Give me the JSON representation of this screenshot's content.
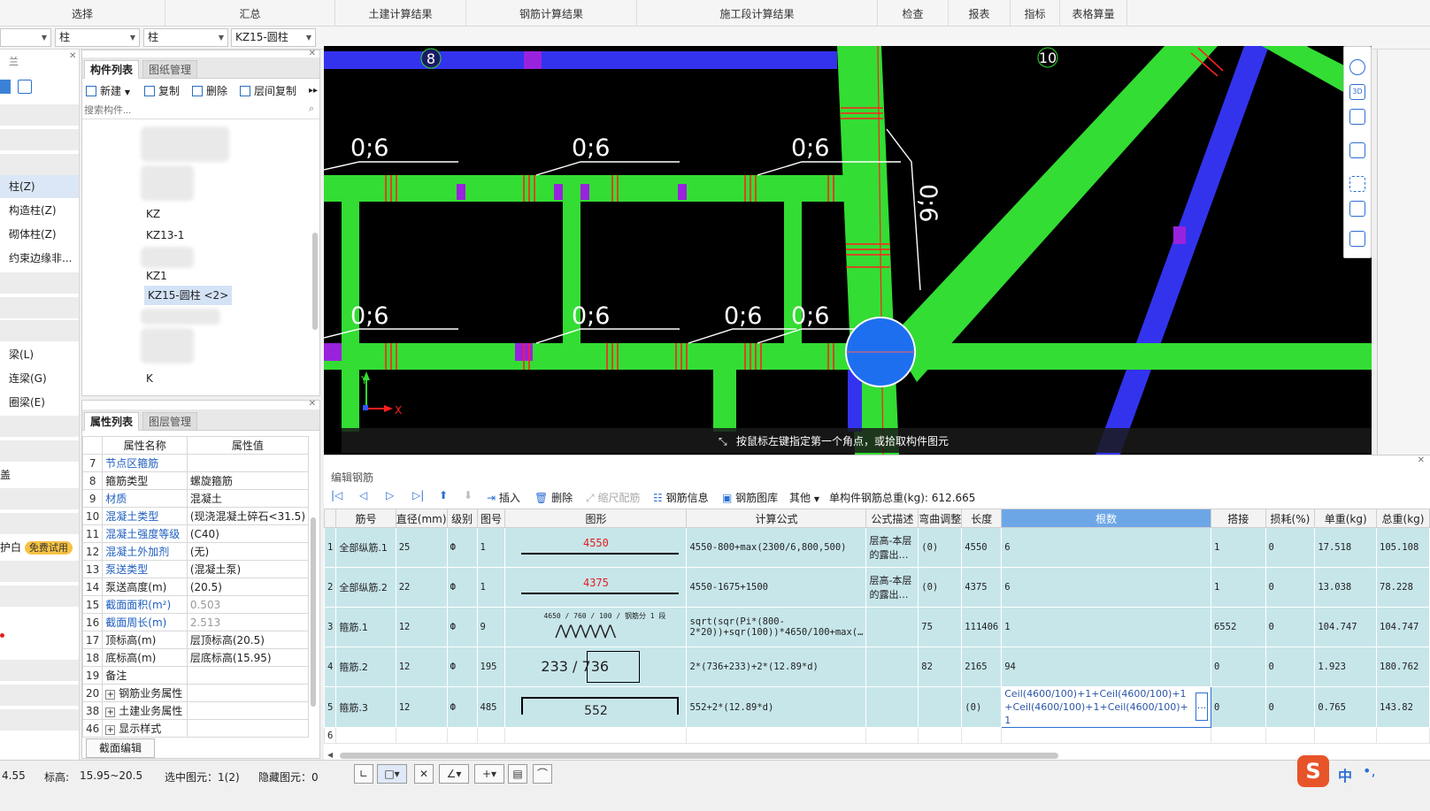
{
  "ribbon": [
    "选择",
    "汇总",
    "土建计算结果",
    "钢筋计算结果",
    "施工段计算结果",
    "检查",
    "报表",
    "指标",
    "表格算量"
  ],
  "selectors": {
    "first": "",
    "second": "柱",
    "third": "柱",
    "fourth": "KZ15-圆柱"
  },
  "nav": {
    "top_label": "兰",
    "items": [
      "柱(Z)",
      "构造柱(Z)",
      "砌体柱(Z)",
      "约束边缘非...",
      "梁(L)",
      "连梁(G)",
      "圈梁(E)",
      "盖",
      "护白"
    ],
    "badge": "免费试用"
  },
  "comp_panel": {
    "tabs": [
      "构件列表",
      "图纸管理"
    ],
    "toolbar": [
      "新建",
      "复制",
      "删除",
      "层间复制"
    ],
    "search_placeholder": "搜索构件...",
    "items": [
      "KZ",
      "KZ13-1",
      "KZ15-圆柱 <2>",
      "KZ1",
      "K",
      "K"
    ]
  },
  "prop_panel": {
    "tabs": [
      "属性列表",
      "图层管理"
    ],
    "headers": [
      "属性名称",
      "属性值"
    ],
    "rows": [
      {
        "n": "7",
        "name": "节点区箍筋",
        "val": "",
        "link": true
      },
      {
        "n": "8",
        "name": "箍筋类型",
        "val": "螺旋箍筋",
        "link": false
      },
      {
        "n": "9",
        "name": "材质",
        "val": "混凝土",
        "link": true
      },
      {
        "n": "10",
        "name": "混凝土类型",
        "val": "(现浇混凝土碎石<31.5)",
        "link": true
      },
      {
        "n": "11",
        "name": "混凝土强度等级",
        "val": "(C40)",
        "link": true
      },
      {
        "n": "12",
        "name": "混凝土外加剂",
        "val": "(无)",
        "link": true
      },
      {
        "n": "13",
        "name": "泵送类型",
        "val": "(混凝土泵)",
        "link": true
      },
      {
        "n": "14",
        "name": "泵送高度(m)",
        "val": "(20.5)",
        "link": false
      },
      {
        "n": "15",
        "name": "截面面积(m²)",
        "val": "0.503",
        "link": true,
        "gray": true
      },
      {
        "n": "16",
        "name": "截面周长(m)",
        "val": "2.513",
        "link": true,
        "gray": true
      },
      {
        "n": "17",
        "name": "顶标高(m)",
        "val": "层顶标高(20.5)",
        "link": false
      },
      {
        "n": "18",
        "name": "底标高(m)",
        "val": "层底标高(15.95)",
        "link": false
      },
      {
        "n": "19",
        "name": "备注",
        "val": "",
        "link": false
      },
      {
        "n": "20",
        "name": "钢筋业务属性",
        "val": "",
        "link": false,
        "exp": true
      },
      {
        "n": "38",
        "name": "土建业务属性",
        "val": "",
        "link": false,
        "exp": true
      },
      {
        "n": "46",
        "name": "显示样式",
        "val": "",
        "link": false,
        "exp": true
      }
    ],
    "edit_button": "截面编辑"
  },
  "canvas": {
    "axis_labels": [
      "8",
      "10"
    ],
    "rebar_labels": [
      "0;6",
      "0;6",
      "0;6",
      "0;6",
      "0;6",
      "0;6",
      "0;6",
      "0;6",
      "0;6"
    ],
    "hint": "按鼠标左键指定第一个角点，或拾取构件图元",
    "axis_x": "X",
    "axis_y": "Y"
  },
  "rebar_panel": {
    "title": "编辑钢筋",
    "toolbar": [
      "插入",
      "删除",
      "缩尺配筋",
      "钢筋信息",
      "钢筋图库",
      "其他"
    ],
    "total": "单构件钢筋总重(kg): 612.665",
    "headers": [
      "",
      "筋号",
      "直径(mm)",
      "级别",
      "图号",
      "图形",
      "计算公式",
      "公式描述",
      "弯曲调整",
      "长度",
      "根数",
      "搭接",
      "损耗(%)",
      "单重(kg)",
      "总重(kg)"
    ],
    "rows": [
      {
        "idx": "1",
        "name": "全部纵筋.1",
        "dia": "25",
        "grade": "Ф",
        "fig": "1",
        "shape": "4550",
        "formula": "4550-800+max(2300/6,800,500)",
        "desc": "层高-本层的露出…",
        "bend": "(0)",
        "len": "4550",
        "count": "6",
        "lap": "1",
        "loss": "0",
        "unit": "17.518",
        "total": "105.108"
      },
      {
        "idx": "2",
        "name": "全部纵筋.2",
        "dia": "22",
        "grade": "Ф",
        "fig": "1",
        "shape": "4375",
        "formula": "4550-1675+1500",
        "desc": "层高-本层的露出…",
        "bend": "(0)",
        "len": "4375",
        "count": "6",
        "lap": "1",
        "loss": "0",
        "unit": "13.038",
        "total": "78.228"
      },
      {
        "idx": "3",
        "name": "箍筋.1",
        "dia": "12",
        "grade": "Ф",
        "fig": "9",
        "shape": "4650 / 760 / 100 / 钢筋分 1 段",
        "formula": "sqrt(sqr(Pi*(800-2*20))+sqr(100))*4650/100+max(…",
        "desc": "",
        "bend": "75",
        "len": "111406",
        "count": "1",
        "lap": "6552",
        "loss": "0",
        "unit": "104.747",
        "total": "104.747"
      },
      {
        "idx": "4",
        "name": "箍筋.2",
        "dia": "12",
        "grade": "Ф",
        "fig": "195",
        "shape": "233 / 736",
        "formula": "2*(736+233)+2*(12.89*d)",
        "desc": "",
        "bend": "82",
        "len": "2165",
        "count": "94",
        "lap": "0",
        "loss": "0",
        "unit": "1.923",
        "total": "180.762"
      },
      {
        "idx": "5",
        "name": "箍筋.3",
        "dia": "12",
        "grade": "Ф",
        "fig": "485",
        "shape": "552",
        "formula": "552+2*(12.89*d)",
        "desc": "",
        "bend": "",
        "len": "(0)",
        "count": "Ceil(4600/100)+1+Ceil(4600/100)+1+Ceil(4600/100)+1+Ceil(4600/100)+1",
        "lap": "0",
        "loss": "0",
        "unit": "0.765",
        "total": "143.82"
      },
      {
        "idx": "6",
        "name": "",
        "dia": "",
        "grade": "",
        "fig": "",
        "shape": "",
        "formula": "",
        "desc": "",
        "bend": "",
        "len": "",
        "count": "",
        "lap": "",
        "loss": "",
        "unit": "",
        "total": ""
      }
    ]
  },
  "status": {
    "coord": "4.55",
    "elev_label": "标高:",
    "elev": "15.95~20.5",
    "selected": "选中图元：1(2)",
    "hidden": "隐藏图元：0"
  },
  "colors": {
    "accent": "#2d6fd3",
    "green": "#33dd33",
    "blue": "#3333ee",
    "purple": "#9922dd",
    "cell": "#c7e6ea"
  }
}
